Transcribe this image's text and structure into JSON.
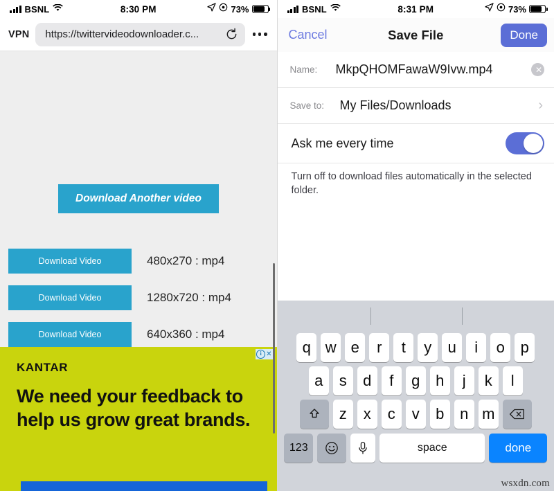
{
  "left_phone": {
    "status_bar": {
      "carrier": "BSNL",
      "time": "8:30 PM",
      "battery_percent": "73%",
      "signal_icon": "cellular-bars-icon",
      "wifi_icon": "wifi-icon",
      "location_icon": "location-arrow-icon",
      "alarm_icon": "alarm-circle-icon",
      "battery_icon": "battery-icon"
    },
    "browser": {
      "vpn_label": "VPN",
      "url": "https://twittervideodownloader.c...",
      "reload_icon": "reload-icon",
      "more_icon": "more-dots-icon"
    },
    "page": {
      "primary_button": "Download Another video",
      "downloads": [
        {
          "button": "Download Video",
          "resolution": "480x270 : mp4"
        },
        {
          "button": "Download Video",
          "resolution": "1280x720 : mp4"
        },
        {
          "button": "Download Video",
          "resolution": "640x360 : mp4"
        }
      ],
      "ad": {
        "brand": "KANTAR",
        "headline": "We need your feedback to help us grow great brands.",
        "adchoices_icon": "adchoices-info-icon",
        "close_icon": "close-x-icon",
        "background_color": "#c9d40d",
        "cta_color": "#1565d8"
      },
      "accent_color": "#29a3cc",
      "background_color": "#eeeeee"
    }
  },
  "right_phone": {
    "status_bar": {
      "carrier": "BSNL",
      "time": "8:31 PM",
      "battery_percent": "73%"
    },
    "navbar": {
      "cancel_label": "Cancel",
      "title": "Save File",
      "done_label": "Done",
      "done_color": "#5b6ed6"
    },
    "form": {
      "name_label": "Name:",
      "name_value": "MkpQHOMFawaW9Ivw.mp4",
      "clear_icon": "clear-circle-icon",
      "save_to_label": "Save to:",
      "save_to_value": "My Files/Downloads",
      "chevron_icon": "chevron-right-icon",
      "toggle_label": "Ask me every time",
      "toggle_on": true,
      "toggle_color": "#5b6ed6",
      "hint": "Turn off to download files automatically in the selected folder."
    },
    "keyboard": {
      "row1": [
        "q",
        "w",
        "e",
        "r",
        "t",
        "y",
        "u",
        "i",
        "o",
        "p"
      ],
      "row2": [
        "a",
        "s",
        "d",
        "f",
        "g",
        "h",
        "j",
        "k",
        "l"
      ],
      "row3": [
        "z",
        "x",
        "c",
        "v",
        "b",
        "n",
        "m"
      ],
      "shift_icon": "shift-arrow-icon",
      "backspace_icon": "backspace-icon",
      "numbers_label": "123",
      "emoji_icon": "emoji-smiley-icon",
      "mic_icon": "microphone-icon",
      "space_label": "space",
      "done_label": "done",
      "done_key_color": "#0a84ff"
    }
  },
  "watermark": "wsxdn.com"
}
